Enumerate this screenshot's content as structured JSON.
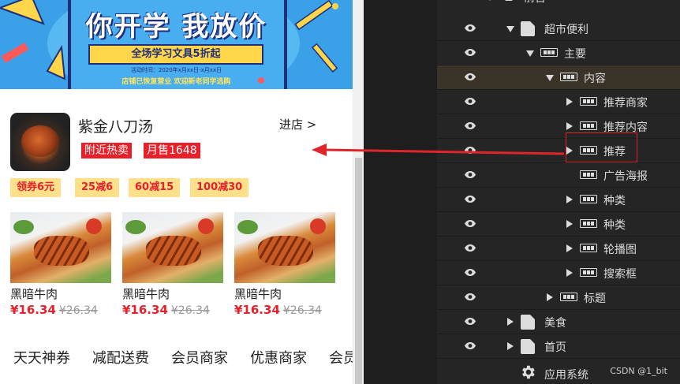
{
  "banner": {
    "headline": "你开学 我放价",
    "ribbon": "全场学习文具5折起",
    "date": "活动时间：2020年x月xx日-x月xx日",
    "footer": "店铺已恢复营业 欢迎新老同学选购"
  },
  "shop": {
    "name": "紫金八刀汤",
    "enter": "进店 >",
    "tags": [
      "附近热卖",
      "月售1648"
    ],
    "coupons": [
      "领券6元",
      "25减6",
      "60减15",
      "100减30"
    ]
  },
  "products": [
    {
      "name": "黑暗牛肉",
      "price": "¥16.34",
      "old_price": "¥26.34"
    },
    {
      "name": "黑暗牛肉",
      "price": "¥16.34",
      "old_price": "¥26.34"
    },
    {
      "name": "黑暗牛肉",
      "price": "¥16.34",
      "old_price": "¥26.34"
    }
  ],
  "bottom_nav": [
    "天天神券",
    "减配送费",
    "会员商家",
    "优惠商家",
    "会员"
  ],
  "layers": {
    "top": "前台",
    "items": [
      {
        "label": "超市便利",
        "icon": "page-icon",
        "expanded": true
      },
      {
        "label": "主要",
        "icon": "box-icon",
        "expanded": true
      },
      {
        "label": "内容",
        "icon": "box-icon",
        "expanded": true
      },
      {
        "label": "推荐商家",
        "icon": "box-icon",
        "expanded": false
      },
      {
        "label": "推荐内容",
        "icon": "box-icon",
        "expanded": false
      },
      {
        "label": "推荐",
        "icon": "box-icon",
        "expanded": false
      },
      {
        "label": "广告海报",
        "icon": "box-icon",
        "expanded": null
      },
      {
        "label": "种类",
        "icon": "box-icon",
        "expanded": false
      },
      {
        "label": "种类",
        "icon": "box-icon",
        "expanded": false
      },
      {
        "label": "轮播图",
        "icon": "box-icon",
        "expanded": false
      },
      {
        "label": "搜索框",
        "icon": "box-icon",
        "expanded": false
      },
      {
        "label": "标题",
        "icon": "box-icon",
        "expanded": false
      },
      {
        "label": "美食",
        "icon": "page-icon",
        "expanded": false
      },
      {
        "label": "首页",
        "icon": "page-icon",
        "expanded": false
      }
    ],
    "system": "应用系统"
  },
  "watermark": "CSDN @1_bit",
  "colors": {
    "accent_red": "#e8202a",
    "coupon_bg": "#ffe08a",
    "panel_bg": "#252526",
    "selected_row": "#3a3328"
  }
}
